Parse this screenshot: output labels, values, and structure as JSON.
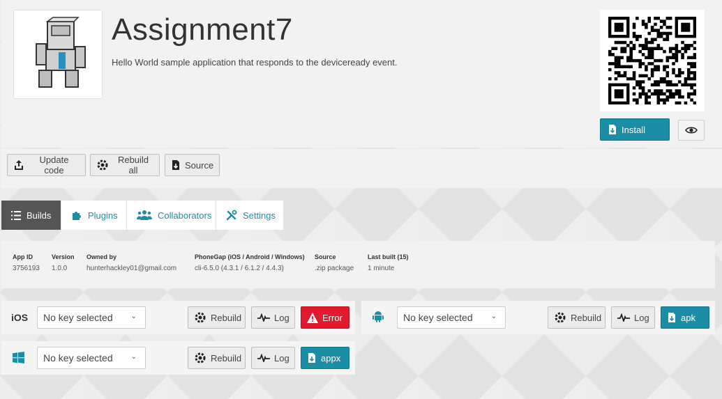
{
  "app": {
    "title": "Assignment7",
    "description": "Hello World sample application that responds to the deviceready event.",
    "icon": "robot-icon",
    "qr_icon": "qr-code-icon"
  },
  "header_actions": {
    "install_label": "Install",
    "install_icon": "install-icon",
    "preview_icon": "eye-icon"
  },
  "toolbar": {
    "update_code_label": "Update code",
    "rebuild_all_label": "Rebuild all",
    "source_label": "Source"
  },
  "tabs": [
    {
      "label": "Builds",
      "icon": "list-icon",
      "active": true
    },
    {
      "label": "Plugins",
      "icon": "puzzle-icon",
      "active": false
    },
    {
      "label": "Collaborators",
      "icon": "users-icon",
      "active": false
    },
    {
      "label": "Settings",
      "icon": "wrench-icon",
      "active": false
    }
  ],
  "info": {
    "app_id": {
      "label": "App ID",
      "value": "3756193"
    },
    "version": {
      "label": "Version",
      "value": "1.0.0"
    },
    "owned_by": {
      "label": "Owned by",
      "value": "hunterhackley01@gmail.com"
    },
    "phonegap": {
      "label": "PhoneGap (iOS / Android / Windows)",
      "value": "cli-6.5.0 (4.3.1 / 6.1.2 / 4.4.3)"
    },
    "source": {
      "label": "Source",
      "value": ".zip package"
    },
    "last_built": {
      "label": "Last built (15)",
      "value": "1 minute"
    }
  },
  "platforms": {
    "ios": {
      "label": "iOS",
      "key": "No key selected",
      "rebuild": "Rebuild",
      "log": "Log",
      "status": "Error"
    },
    "android": {
      "label": "",
      "icon": "android-icon",
      "key": "No key selected",
      "rebuild": "Rebuild",
      "log": "Log",
      "status": "apk"
    },
    "windows": {
      "label": "",
      "icon": "windows-icon",
      "key": "No key selected",
      "rebuild": "Rebuild",
      "log": "Log",
      "status": "appx"
    }
  },
  "colors": {
    "accent": "#1b8ea6",
    "error": "#e21a30",
    "active_tab": "#555555"
  }
}
